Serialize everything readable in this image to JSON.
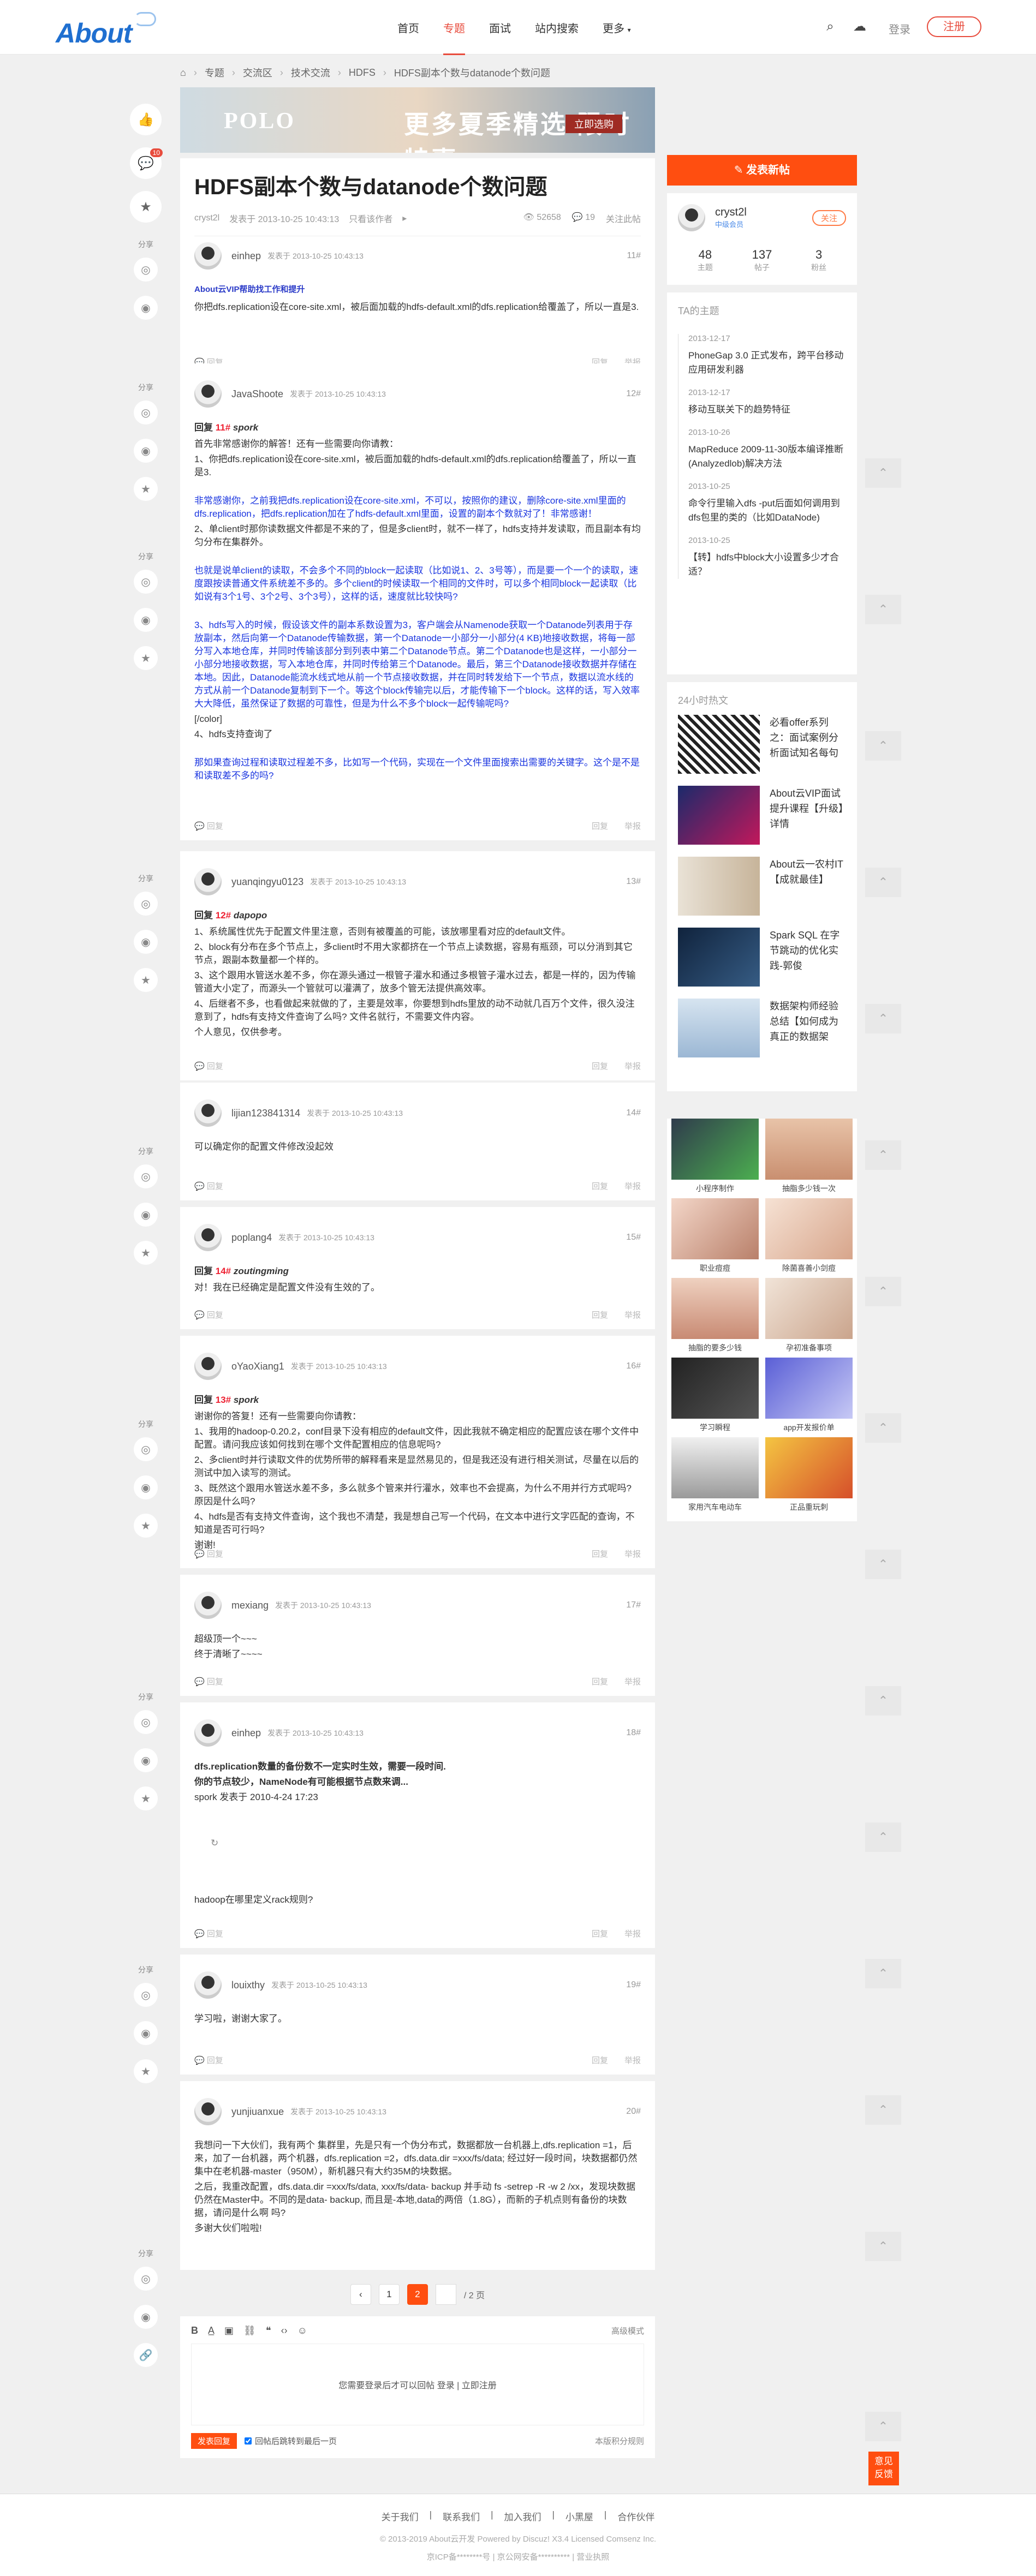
{
  "header": {
    "logo": "About",
    "nav": [
      "首页",
      "专题",
      "面试",
      "站内搜索",
      "更多"
    ],
    "active_nav": 1,
    "login": "登录",
    "register": "注册"
  },
  "breadcrumb": [
    "专题",
    "交流区",
    "技术交流",
    "HDFS",
    "HDFS副本个数与datanode个数问题"
  ],
  "ad": {
    "brand": "POLO",
    "slogan": "更多夏季精选 限时特惠",
    "cta": "立即选购"
  },
  "left_bar": {
    "comment_badge": "10"
  },
  "share_label": "分享",
  "thread": {
    "title": "HDFS副本个数与datanode个数问题",
    "author": "cryst2l",
    "posted": "发表于 2013-10-25 10:43:13",
    "view_all": "只看该作者",
    "views": "52658",
    "replies": "19",
    "subscribe": "关注此帖",
    "reply_label": "回复",
    "report_label": "举报",
    "quote_label": "回复"
  },
  "posts": [
    {
      "user": "einhep",
      "time": "发表于 2013-10-25 10:43:13",
      "floor": "11#",
      "vip": "About云VIP帮助找工作和提升",
      "lines": [
        "你把dfs.replication设在core-site.xml，被后面加载的hdfs-default.xml的dfs.replication给覆盖了，所以一直是3."
      ]
    },
    {
      "user": "JavaShoote",
      "time": "发表于 2013-10-25 10:43:13",
      "floor": "12#",
      "quote_who": "11#",
      "quote_name": "spork",
      "lines": [
        "首先非常感谢你的解答！还有一些需要向你请教：",
        "1、你把dfs.replication设在core-site.xml，被后面加载的hdfs-default.xml的dfs.replication给覆盖了，所以一直是3."
      ],
      "blue1": "非常感谢你，之前我把dfs.replication设在core-site.xml，不可以，按照你的建议，删除core-site.xml里面的dfs.replication，把dfs.replication加在了hdfs-default.xml里面，设置的副本个数就对了！非常感谢！",
      "line2": "2、单client时那你读数据文件都是不来的了，但是多client时，就不一样了，hdfs支持并发读取，而且副本有均匀分布在集群外。",
      "blue2": "也就是说单client的读取，不会多个不同的block一起读取（比如说1、2、3号等），而是要一个一个的读取，速度跟按读普通文件系统差不多的。多个client的时候读取一个相同的文件时，可以多个相同block一起读取（比如说有3个1号、3个2号、3个3号），这样的话，速度就比较快吗?",
      "blue3": "3、hdfs写入的时候，假设该文件的副本系数设置为3，客户端会从Namenode获取一个Datanode列表用于存放副本，然后向第一个Datanode传输数据，第一个Datanode一小部分一小部分(4 KB)地接收数据，将每一部分写入本地仓库，并同时传输该部分到列表中第二个Datanode节点。第二个Datanode也是这样，一小部分一小部分地接收数据，写入本地仓库，并同时传给第三个Datanode。最后，第三个Datanode接收数据并存储在本地。因此，Datanode能流水线式地从前一个节点接收数据，并在同时转发给下一个节点，数据以流水线的方式从前一个Datanode复制到下一个。等这个block传输完以后，才能传输下一个block。这样的话，写入效率大大降低，虽然保证了数据的可靠性，但是为什么不多个block一起传输呢吗?",
      "color_tag": "[/color]",
      "line4": "4、hdfs支持查询了",
      "blue4": "那如果查询过程和读取过程差不多，比如写一个代码，实现在一个文件里面搜索出需要的关键字。这个是不是和读取差不多的吗?"
    },
    {
      "user": "yuanqingyu0123",
      "time": "发表于 2013-10-25 10:43:13",
      "floor": "13#",
      "quote_who": "12#",
      "quote_name": "dapopo",
      "lines": [
        "1、系统属性优先于配置文件里注意，否则有被覆盖的可能，该放哪里看对应的default文件。",
        "2、block有分布在多个节点上，多client时不用大家都挤在一个节点上读数据，容易有瓶颈，可以分消到其它节点，跟副本数量都一个样的。",
        "3、这个跟用水管送水差不多，你在源头通过一根管子灌水和通过多根管子灌水过去，都是一样的，因为传输管道大小定了，而源头一个管就可以灌满了，放多个管无法提供高效率。",
        "4、后继者不多，也看做起来就做的了，主要是效率，你要想到hdfs里放的动不动就几百万个文件，很久没注意到了，hdfs有支持文件查询了么吗? 文件名就行，不需要文件内容。",
        "个人意见，仅供参考。"
      ]
    },
    {
      "user": "lijian123841314",
      "time": "发表于 2013-10-25 10:43:13",
      "floor": "14#",
      "lines": [
        "可以确定你的配置文件修改没起效"
      ]
    },
    {
      "user": "poplang4",
      "time": "发表于 2013-10-25 10:43:13",
      "floor": "15#",
      "quote_who": "14#",
      "quote_name": "zoutingming",
      "lines": [
        "对！我在已经确定是配置文件没有生效的了。"
      ]
    },
    {
      "user": "oYaoXiang1",
      "time": "发表于 2013-10-25 10:43:13",
      "floor": "16#",
      "quote_who": "13#",
      "quote_name": "spork",
      "lines": [
        "谢谢你的答复！还有一些需要向你请教：",
        "1、我用的hadoop-0.20.2，conf目录下没有相应的default文件，因此我就不确定相应的配置应该在哪个文件中配置。请问我应该如何找到在哪个文件配置相应的信息呢吗?",
        "2、多client时并行读取文件的优势所带的解释看来是显然易见的，但是我还没有进行相关测试，尽量在以后的测试中加入读写的测试。",
        "3、既然这个跟用水管送水差不多，多么就多个管来并行灌水，效率也不会提高，为什么不用并行方式呢吗? 原因是什么吗?",
        "4、hdfs是否有支持文件查询，这个我也不清楚，我是想自己写一个代码，在文本中进行文字匹配的查询，不知道是否可行吗?",
        "谢谢!"
      ]
    },
    {
      "user": "mexiang",
      "time": "发表于 2013-10-25 10:43:13",
      "floor": "17#",
      "lines": [
        "超级顶一个~~~",
        "终于清晰了~~~~"
      ]
    },
    {
      "user": "einhep",
      "time": "发表于 2013-10-25 10:43:13",
      "floor": "18#",
      "bold": [
        "dfs.replication数量的备份数不一定实时生效，需要一段时间.",
        "你的节点较少，NameNode有可能根据节点数来调..."
      ],
      "lines": [
        "spork 发表于 2010-4-24 17:23"
      ],
      "tail": "hadoop在哪里定义rack规则?"
    },
    {
      "user": "louixthy",
      "time": "发表于 2013-10-25 10:43:13",
      "floor": "19#",
      "lines": [
        "学习啦，谢谢大家了。"
      ]
    },
    {
      "user": "yunjiuanxue",
      "time": "发表于 2013-10-25 10:43:13",
      "floor": "20#",
      "lines": [
        "我想问一下大伙们，我有两个 集群里，先是只有一个伪分布式，数据都放一台机器上,dfs.replication =1，后来，加了一台机器，两个机器，dfs.replication =2，dfs.data.dir =xxx/fs/data; 经过好一段时间，块数据都仍然集中在老机器-master（950M），新机器只有大约35M的块数据。",
        "之后，我重改配置，dfs.data.dir =xxx/fs/data, xxx/fs/data- backup 并手动 fs -setrep -R -w 2 /xx，发现块数据仍然在Master中。不同的是data- backup, 而且是-本地,data的两倍（1.8G），而新的子机点则有备份的块数据，请问是什么啊 吗?",
        "多谢大伙们啦啦!"
      ]
    }
  ],
  "sidebar": {
    "new_post": "发表新帖",
    "user": {
      "name": "cryst2l",
      "level": "中级会员",
      "follow": "关注",
      "stats": [
        {
          "n": "48",
          "l": "主题"
        },
        {
          "n": "137",
          "l": "帖子"
        },
        {
          "n": "3",
          "l": "粉丝"
        }
      ]
    },
    "topics_title": "TA的主题",
    "topics": [
      {
        "date": "2013-12-17",
        "title": "PhoneGap 3.0 正式发布，跨平台移动应用研发利器"
      },
      {
        "date": "2013-12-17",
        "title": "移动互联关下的趋势特征"
      },
      {
        "date": "2013-10-26",
        "title": "MapReduce 2009-11-30版本编译推断(Analyzedlob)解决方法"
      },
      {
        "date": "2013-10-25",
        "title": "命令行里输入dfs -put后面如何调用到dfs包里的类的（比如DataNode)"
      },
      {
        "date": "2013-10-25",
        "title": "【转】hdfs中block大小设置多少才合适？"
      }
    ],
    "hot_title": "24小时热文",
    "hot": [
      {
        "title": "必看offer系列之：面试案例分析面试知名每句"
      },
      {
        "title": "About云VIP面试提升课程【升级】详情"
      },
      {
        "title": "About云一农村IT【成就最佳】"
      },
      {
        "title": "Spark SQL 在字节跳动的优化实践-郭俊"
      },
      {
        "title": "数据架构师经验总结【如何成为真正的数据架"
      }
    ],
    "gallery": [
      "小程序制作",
      "抽脂多少钱一次",
      "职业痘痘",
      "除菌喜善小剑痘",
      "抽脂的要多少钱",
      "孕初准备事项",
      "学习瞬程",
      "app开发报价单",
      "家用汽车电动车",
      "正品重玩刺"
    ]
  },
  "pager": {
    "prev": "‹",
    "pages": [
      "1",
      "2"
    ],
    "current": "2",
    "next": "/ 2 页"
  },
  "editor": {
    "advanced": "高级模式",
    "prompt": "您需要登录后才可以回帖 登录 | 立即注册",
    "send": "发表回复",
    "check": "回帖后跳转到最后一页",
    "score": "本版积分规则"
  },
  "feedback": "意见\n反馈",
  "footer": {
    "links": [
      "关于我们",
      "联系我们",
      "加入我们",
      "小黑屋",
      "合作伙伴"
    ],
    "copy": "© 2013-2019 About云开发 Powered by Discuz! X3.4 Licensed Comsenz Inc.",
    "lic": "京ICP备********号   |   京公网安备**********   |   营业执照"
  },
  "colors": {
    "accent": "#ff4e10",
    "red": "#e84c3d",
    "link_blue": "#1a35e0",
    "logo_blue": "#1f6fd0"
  }
}
